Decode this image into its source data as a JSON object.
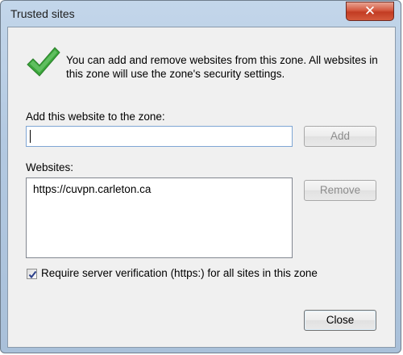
{
  "window": {
    "title": "Trusted sites",
    "close_glyph": "✕"
  },
  "intro": {
    "icon": "green-checkmark-icon",
    "text": "You can add and remove websites from this zone. All websites in this zone will use the zone's security settings."
  },
  "add_site": {
    "label": "Add this website to the zone:",
    "value": "",
    "placeholder": "",
    "button_label": "Add"
  },
  "websites": {
    "label": "Websites:",
    "items": [
      "https://cuvpn.carleton.ca"
    ],
    "remove_label": "Remove"
  },
  "verification": {
    "checked": true,
    "label": "Require server verification (https:) for all sites in this zone"
  },
  "footer": {
    "close_label": "Close"
  },
  "colors": {
    "frame": "#b3c9e1",
    "client": "#f0f0f0",
    "check_green": "#3aa63a",
    "close_red": "#c9452c"
  }
}
